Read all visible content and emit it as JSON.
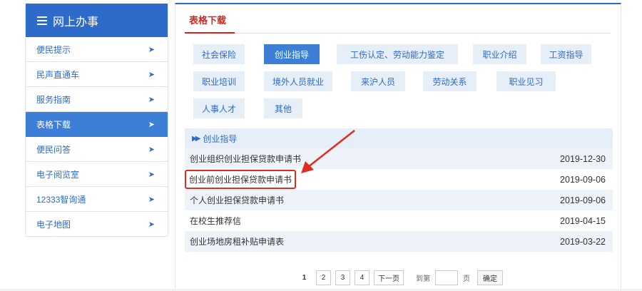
{
  "sidebar": {
    "title": "网上办事",
    "items": [
      {
        "label": "便民提示",
        "active": false
      },
      {
        "label": "民声直通车",
        "active": false
      },
      {
        "label": "服务指南",
        "active": false
      },
      {
        "label": "表格下载",
        "active": true
      },
      {
        "label": "便民问答",
        "active": false
      },
      {
        "label": "电子阅览室",
        "active": false
      },
      {
        "label": "12333智询通",
        "active": false
      },
      {
        "label": "电子地图",
        "active": false
      }
    ],
    "arrow_glyph": "➤"
  },
  "main": {
    "title": "表格下载",
    "categories": [
      {
        "label": "社会保险",
        "active": false
      },
      {
        "label": "创业指导",
        "active": true
      },
      {
        "label": "工伤认定、劳动能力鉴定",
        "active": false
      },
      {
        "label": "职业介绍",
        "active": false
      },
      {
        "label": "工资指导",
        "active": false
      },
      {
        "label": "职业培训",
        "active": false
      },
      {
        "label": "境外人员就业",
        "active": false
      },
      {
        "label": "来沪人员",
        "active": false
      },
      {
        "label": "劳动关系",
        "active": false
      },
      {
        "label": "职业见习",
        "active": false
      },
      {
        "label": "人事人才",
        "active": false
      },
      {
        "label": "其他",
        "active": false
      }
    ],
    "list_header": "创业指导",
    "rows": [
      {
        "title": "创业组织创业担保贷款申请书",
        "date": "2019-12-30"
      },
      {
        "title": "创业前创业担保贷款申请书",
        "date": "2019-09-06",
        "highlight": true
      },
      {
        "title": "个人创业担保贷款申请书",
        "date": "2019-09-06"
      },
      {
        "title": "在校生推荐信",
        "date": "2019-04-15"
      },
      {
        "title": "创业场地房租补贴申请表",
        "date": "2019-03-22"
      }
    ]
  },
  "pagination": {
    "current": "1",
    "pages": [
      "2",
      "3",
      "4"
    ],
    "next_label": "下一页",
    "goto_label": "到第",
    "page_unit": "页",
    "confirm_label": "确定",
    "goto_value": ""
  },
  "colors": {
    "primary": "#2c6bc9",
    "active": "#3d7fd6",
    "accent_red": "#d6231c",
    "light_bg": "#e6eef8"
  }
}
